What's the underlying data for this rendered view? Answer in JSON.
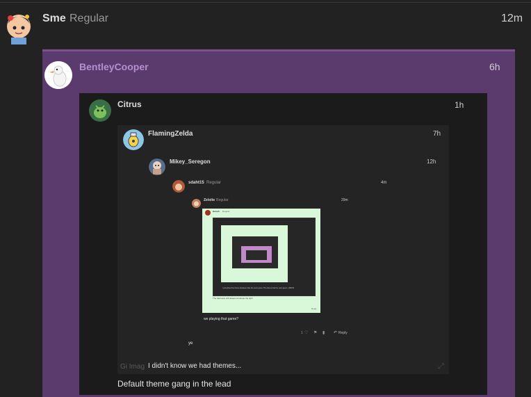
{
  "colors": {
    "page_bg": "#222222",
    "quote_purple": "#5b3a6e",
    "nested_bg": "#1b1b1b",
    "nested_bg2": "#232323",
    "mint": "#d9f8d9"
  },
  "outer_post": {
    "author": "Sme",
    "user_title": "Regular",
    "time": "12m",
    "avatar_icon": "anime-avatar-icon"
  },
  "quote1": {
    "author": "BentleyCooper",
    "time": "6h",
    "avatar_icon": "goose-avatar-icon"
  },
  "quote2": {
    "author": "Citrus",
    "time": "1h",
    "avatar_icon": "bird-avatar-icon",
    "body": "Default theme gang in the lead"
  },
  "quote3": {
    "author": "FlamingZelda",
    "time": "7h",
    "avatar_icon": "lamp-avatar-icon",
    "body": "I didn't know we had themes...",
    "footer_hint": "Gi Imag"
  },
  "quote4": {
    "author": "Mikey_Seregon",
    "time": "12h",
    "avatar_icon": "doll-avatar-icon"
  },
  "quote5": {
    "author": "sdaht15",
    "user_title": "Regular",
    "time": "4m",
    "body": "ye"
  },
  "quote6": {
    "author": "Zeloite",
    "user_title": "Regular",
    "time": "29m",
    "body": "we playing that game?",
    "action_like": "1",
    "action_reply": "Reply"
  },
  "quote7": {
    "author": "Harrah",
    "user_title": "Regular",
    "inner_caption": "I just joined the theme because i like the neon green. The theme had the neon green. (NSFW",
    "inner_caption2": "The darkness will always envelope the light",
    "action_reply": "Reply"
  }
}
